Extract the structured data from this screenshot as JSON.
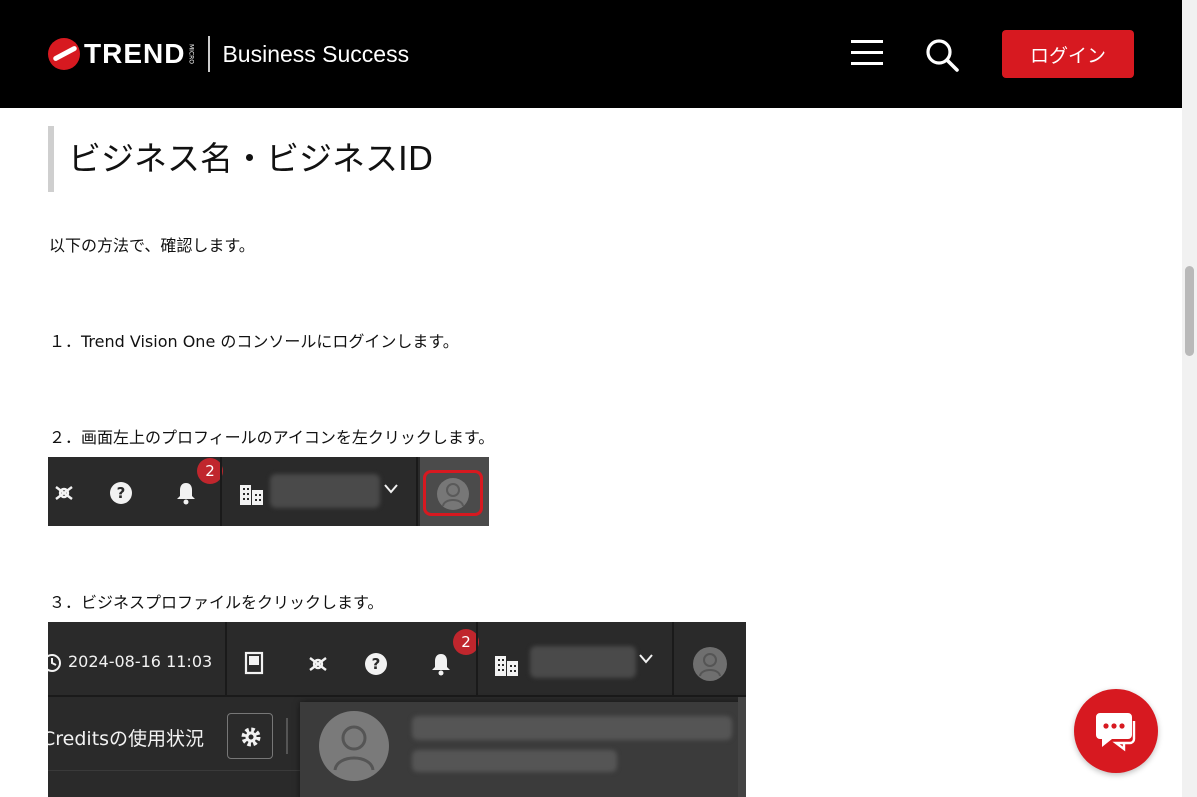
{
  "header": {
    "logo_text": "TREND",
    "logo_micro": "MICRO",
    "site_title": "Business Success",
    "login_label": "ログイン"
  },
  "article": {
    "heading": "ビジネス名・ビジネスID",
    "intro": "以下の方法で、確認します。",
    "steps": [
      "１．Trend Vision One のコンソールにログインします。",
      "２．画面左上のプロフィールのアイコンを左クリックします。",
      "３．ビジネスプロファイルをクリックします。"
    ]
  },
  "screenshot1": {
    "notification_count": "2"
  },
  "screenshot2": {
    "datetime": "2024-08-16 11:03",
    "notification_count": "2",
    "credits_label": "Creditsの使用状況"
  },
  "icons": {
    "menu": "hamburger-icon",
    "search": "search-icon",
    "chat": "chat-icon"
  },
  "colors": {
    "brand_red": "#d71920",
    "header_bg": "#000000"
  }
}
